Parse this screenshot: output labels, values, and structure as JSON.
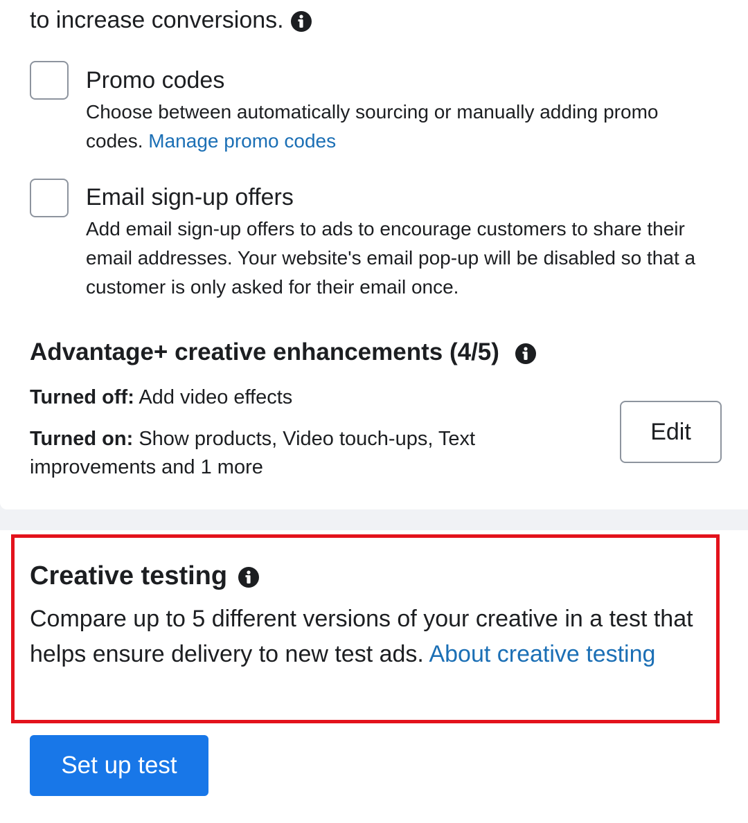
{
  "intro": {
    "text": "to increase conversions."
  },
  "promo_codes": {
    "title": "Promo codes",
    "description": "Choose between automatically sourcing or manually adding promo codes.",
    "link": "Manage promo codes"
  },
  "email_offers": {
    "title": "Email sign-up offers",
    "description": "Add email sign-up offers to ads to encourage customers to share their email addresses. Your website's email pop-up will be disabled so that a customer is only asked for their email once."
  },
  "enhancements": {
    "title": "Advantage+ creative enhancements (4/5)",
    "off_label": "Turned off:",
    "off_value": "Add video effects",
    "on_label": "Turned on:",
    "on_value": "Show products, Video touch-ups, Text improvements and 1 more",
    "edit_label": "Edit"
  },
  "creative_testing": {
    "title": "Creative testing",
    "description": "Compare up to 5 different versions of your creative in a test that helps ensure delivery to new test ads.",
    "link": "About creative testing",
    "button_label": "Set up test"
  },
  "colors": {
    "link": "#1b6fb5",
    "primary_button": "#1877e8",
    "highlight_border": "#e3121c"
  },
  "icons": {
    "info": "info-icon"
  }
}
